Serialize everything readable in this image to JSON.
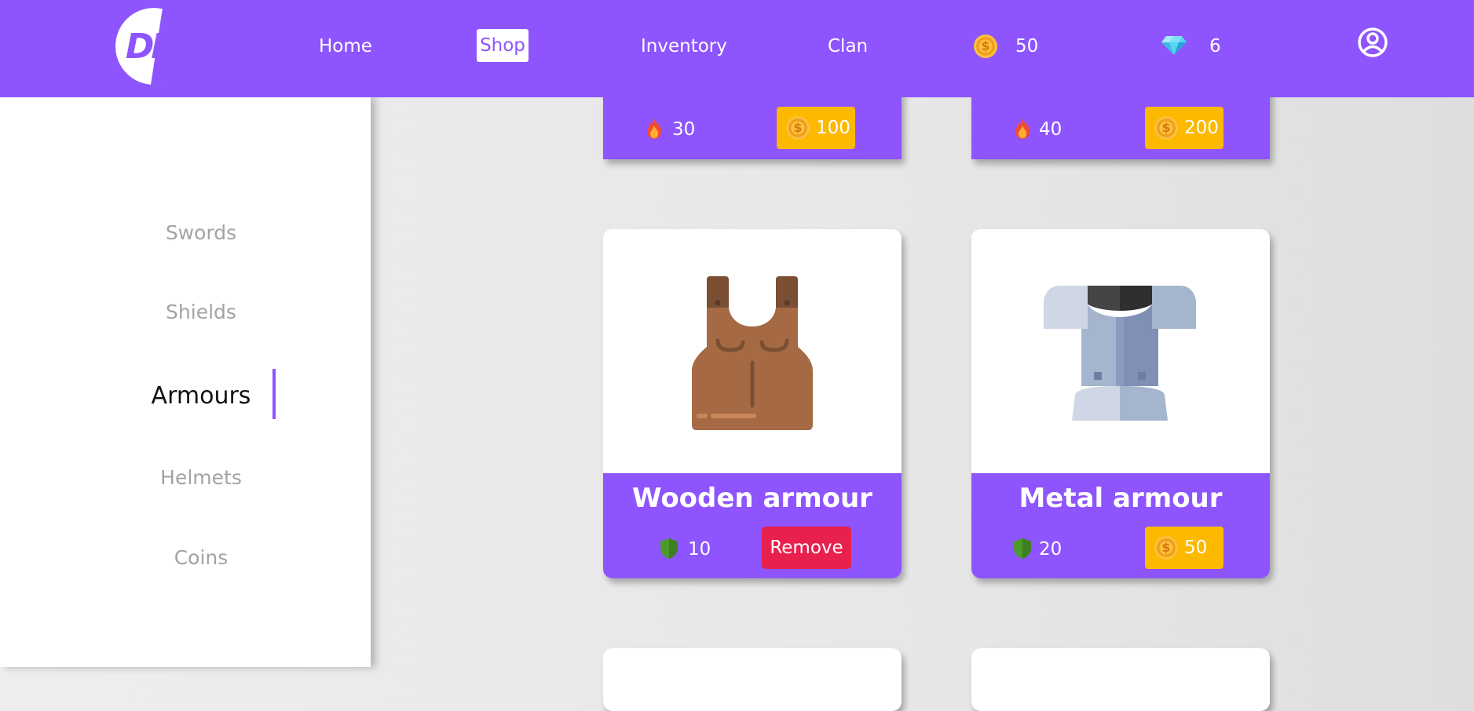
{
  "logo": {
    "text": "DM"
  },
  "nav": {
    "home": "Home",
    "shop": "Shop",
    "inventory": "Inventory",
    "clan": "Clan"
  },
  "wallet": {
    "coins": "50",
    "gems": "6"
  },
  "sidebar": {
    "items": [
      "Swords",
      "Shields",
      "Armours",
      "Helmets",
      "Coins"
    ],
    "active": "Armours"
  },
  "cards_top": [
    {
      "stat_icon": "fire-icon",
      "stat": "30",
      "price": "100"
    },
    {
      "stat_icon": "fire-icon",
      "stat": "40",
      "price": "200"
    }
  ],
  "cards": [
    {
      "name": "Wooden armour",
      "image": "wooden-armour-icon",
      "stat_icon": "shield-icon",
      "stat": "10",
      "action": "Remove"
    },
    {
      "name": "Metal armour",
      "image": "metal-armour-icon",
      "stat_icon": "shield-icon",
      "stat": "20",
      "price": "50"
    }
  ],
  "colors": {
    "primary": "#8e54fd",
    "price_button": "#fdb900",
    "remove_button": "#e8204d",
    "sidebar_inactive": "#a3a3a3"
  }
}
